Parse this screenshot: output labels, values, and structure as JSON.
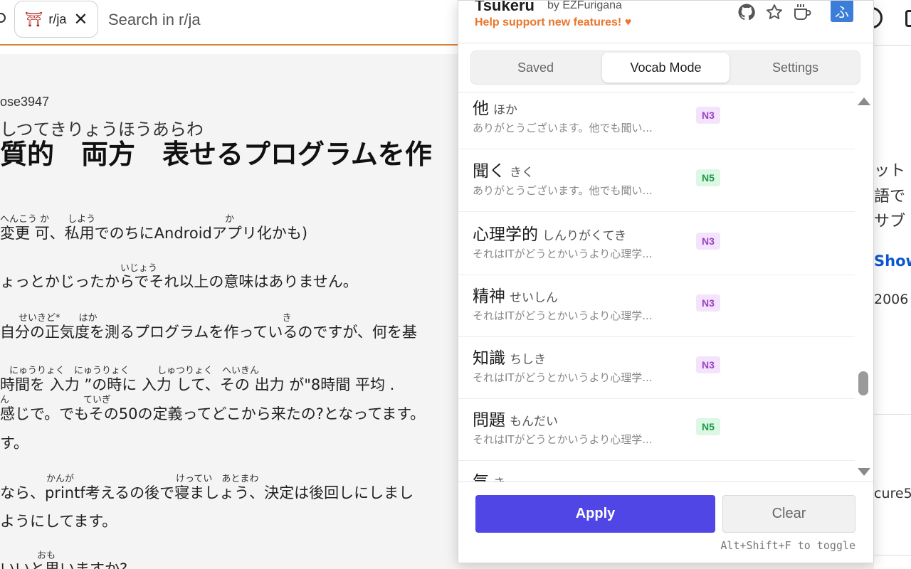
{
  "reddit": {
    "subreddit_chip": "r/ja",
    "search_placeholder": "Search in r/ja",
    "username": "ose3947",
    "title_ruby": "しつてきりょうほうあらわ",
    "title": "質的　両方　表せるプログラムを作",
    "body": [
      {
        "ruby": "へんこう か　　しよう　　　　　　　　　　　　　　か",
        "text": "変更 可、私用でのちにAndroidアプリ化かも)"
      },
      {
        "ruby": "　　　　　　　　　　　　　いじょう",
        "text": "ょっとかじったからでそれ以上の意味はありません。"
      },
      {
        "ruby": "　　せいきど*　　はか　　　　　　　　　　　　　　　　　　　　き",
        "text": "自分の正気度を測るプログラムを作っているのですが、何を基"
      },
      {
        "ruby": "　にゅうりょく　にゅうりょく　　　しゅつりょく　へいきん",
        "text": "時間を  入力 ”の時に  入力  して、その  出力  が\"8時間 平均 ."
      },
      {
        "ruby": "ん　　　　　　　　ていぎ",
        "text": "感じで。でもその50の定義ってどこから来たの?となってます。"
      },
      {
        "ruby": "",
        "text": "す。"
      },
      {
        "ruby": "　　　　　かんが　　　　　　　　　　　けってい　あとまわ",
        "text": "なら、printf考えるの後で寝ましょう、決定は後回しにしまし"
      },
      {
        "ruby": "",
        "text": "ようにしてます。"
      },
      {
        "ruby": "　　　　おも",
        "text": "いいと思いますか?"
      }
    ],
    "sidebar": {
      "line1": "ット",
      "line2": "語で",
      "line3": "サブ",
      "show": "Show",
      "year": "2006",
      "tail": "cure5"
    }
  },
  "extension": {
    "app_name": "Tsukeru",
    "by": "by EZFurigana",
    "support": "Help support new features! ♥",
    "logo": "ふ",
    "header_icons": [
      "github-icon",
      "star-icon",
      "coffee-icon"
    ],
    "tabs": [
      {
        "label": "Saved",
        "active": false
      },
      {
        "label": "Vocab Mode",
        "active": true
      },
      {
        "label": "Settings",
        "active": false
      }
    ],
    "vocab": [
      {
        "word": "他",
        "reading": "ほか",
        "example": "ありがとうございます。他でも聞い...",
        "level": "N3"
      },
      {
        "word": "聞く",
        "reading": "きく",
        "example": "ありがとうございます。他でも聞い...",
        "level": "N5"
      },
      {
        "word": "心理学的",
        "reading": "しんりがくてき",
        "example": "それはITがどうとかいうより心理学...",
        "level": "N3"
      },
      {
        "word": "精神",
        "reading": "せいしん",
        "example": "それはITがどうとかいうより心理学...",
        "level": "N3"
      },
      {
        "word": "知識",
        "reading": "ちしき",
        "example": "それはITがどうとかいうより心理学...",
        "level": "N3"
      },
      {
        "word": "問題",
        "reading": "もんだい",
        "example": "それはITがどうとかいうより心理学...",
        "level": "N5"
      },
      {
        "word": "気",
        "reading": "き",
        "example": "",
        "level": ""
      }
    ],
    "apply_label": "Apply",
    "clear_label": "Clear",
    "shortcut_hint": "Alt+Shift+F to toggle"
  }
}
